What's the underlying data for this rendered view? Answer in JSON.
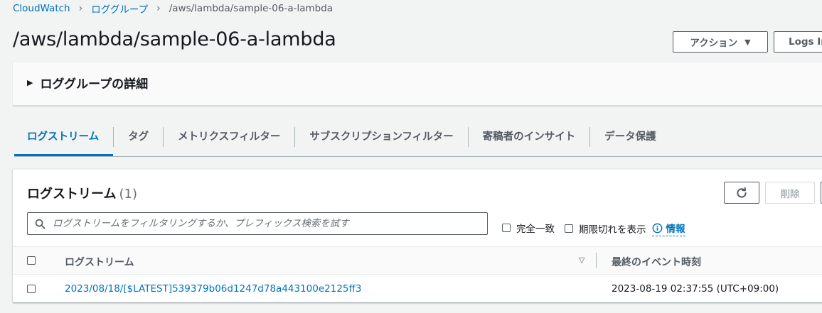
{
  "breadcrumb": {
    "items": [
      "CloudWatch",
      "ロググループ"
    ],
    "current": "/aws/lambda/sample-06-a-lambda"
  },
  "page": {
    "title": "/aws/lambda/sample-06-a-lambda",
    "actions_label": "アクション",
    "logs_insights_label": "Logs In"
  },
  "details": {
    "label": "ロググループの詳細"
  },
  "tabs": [
    {
      "label": "ログストリーム",
      "active": true
    },
    {
      "label": "タグ"
    },
    {
      "label": "メトリクスフィルター"
    },
    {
      "label": "サブスクリプションフィルター"
    },
    {
      "label": "寄稿者のインサイト"
    },
    {
      "label": "データ保護"
    }
  ],
  "streams": {
    "heading": "ログストリーム",
    "count": "(1)",
    "delete_label": "削除",
    "search_placeholder": "ログストリームをフィルタリングするか、プレフィックス検索を試す",
    "exact_match_label": "完全一致",
    "show_expired_label": "期限切れを表示",
    "info_label": "情報",
    "columns": [
      "ログストリーム",
      "最終のイベント時刻"
    ],
    "rows": [
      {
        "name": "2023/08/18/[$LATEST]539379b06d1247d78a443100e2125ff3",
        "last_event": "2023-08-19 02:37:55 (UTC+09:00)"
      }
    ]
  },
  "colors": {
    "link": "#0073bb",
    "background": "#f2f3f3",
    "border": "#545b64"
  }
}
